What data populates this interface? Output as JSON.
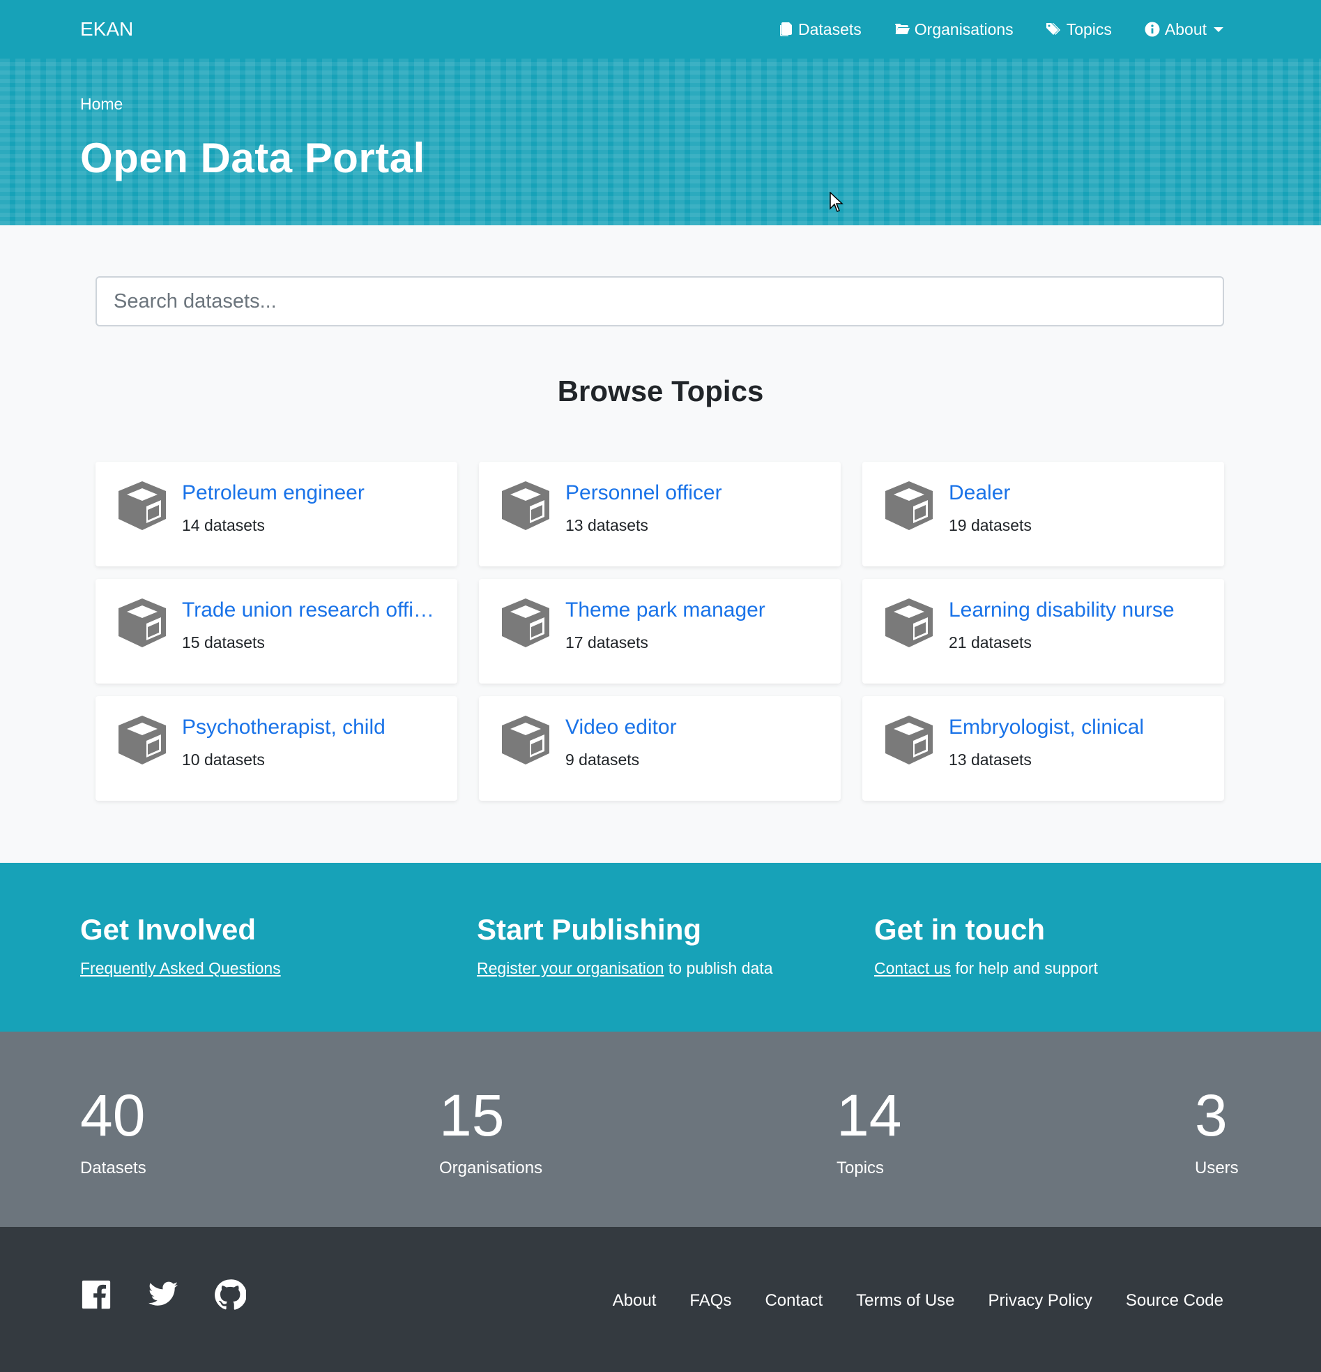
{
  "nav": {
    "brand": "EKAN",
    "items": [
      {
        "label": "Datasets",
        "icon": "copy-icon"
      },
      {
        "label": "Organisations",
        "icon": "folder-open-icon"
      },
      {
        "label": "Topics",
        "icon": "tags-icon"
      },
      {
        "label": "About",
        "icon": "info-circle-icon"
      }
    ]
  },
  "hero": {
    "breadcrumb": "Home",
    "title": "Open Data Portal"
  },
  "search": {
    "placeholder": "Search datasets..."
  },
  "topics": {
    "title": "Browse Topics",
    "icon": "cube-icon",
    "items": [
      {
        "name": "Petroleum engineer",
        "count": "14 datasets"
      },
      {
        "name": "Personnel officer",
        "count": "13 datasets"
      },
      {
        "name": "Dealer",
        "count": "19 datasets"
      },
      {
        "name": "Trade union research officer",
        "count": "15 datasets"
      },
      {
        "name": "Theme park manager",
        "count": "17 datasets"
      },
      {
        "name": "Learning disability nurse",
        "count": "21 datasets"
      },
      {
        "name": "Psychotherapist, child",
        "count": "10 datasets"
      },
      {
        "name": "Video editor",
        "count": "9 datasets"
      },
      {
        "name": "Embryologist, clinical",
        "count": "13 datasets"
      }
    ]
  },
  "cta": {
    "involved": {
      "title": "Get Involved",
      "link": "Frequently Asked Questions"
    },
    "publishing": {
      "title": "Start Publishing",
      "link": "Register your organisation",
      "text": " to publish data"
    },
    "touch": {
      "title": "Get in touch",
      "link": "Contact us",
      "text": " for help and support"
    }
  },
  "stats": [
    {
      "value": "40",
      "label": "Datasets"
    },
    {
      "value": "15",
      "label": "Organisations"
    },
    {
      "value": "14",
      "label": "Topics"
    },
    {
      "value": "3",
      "label": "Users"
    }
  ],
  "footer": {
    "social": [
      "facebook-icon",
      "twitter-icon",
      "github-icon"
    ],
    "links": [
      "About",
      "FAQs",
      "Contact",
      "Terms of Use",
      "Privacy Policy",
      "Source Code"
    ]
  },
  "colors": {
    "primary": "#17a2b8",
    "link": "#1a73e8",
    "stats_bg": "#6c757d",
    "footer_bg": "#343a40"
  }
}
